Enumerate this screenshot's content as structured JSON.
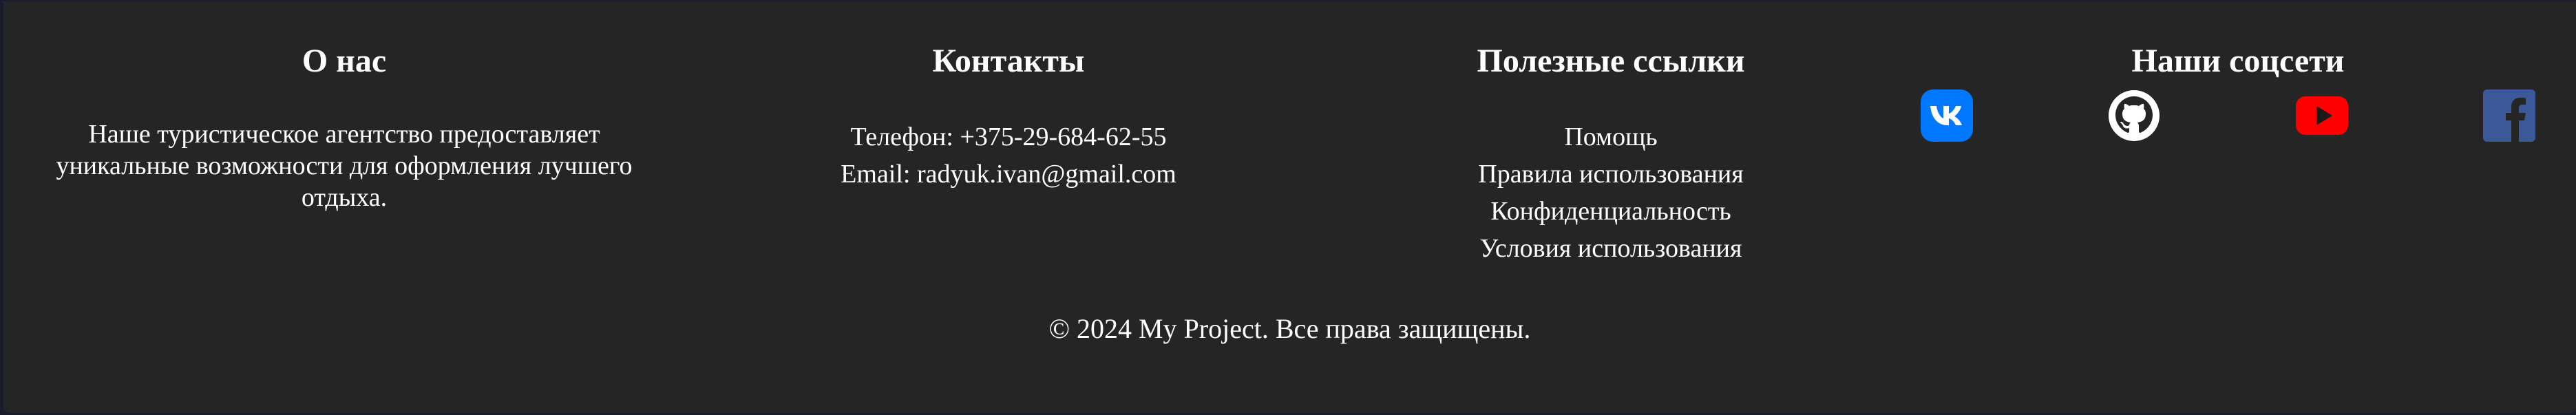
{
  "footer": {
    "about": {
      "title": "О нас",
      "text": "Наше туристическое агентство предоставляет уникальные возможности для оформления лучшего отдыха."
    },
    "contacts": {
      "title": "Контакты",
      "phone": "Телефон: +375-29-684-62-55",
      "email": "Email: radyuk.ivan@gmail.com"
    },
    "links": {
      "title": "Полезные ссылки",
      "items": [
        "Помощь",
        "Правила использования",
        "Конфиденциальность",
        "Условия использования"
      ]
    },
    "social": {
      "title": "Наши соцсети",
      "icons": [
        {
          "name": "vk-icon",
          "color": "#0077ff"
        },
        {
          "name": "github-icon",
          "color": "#ffffff"
        },
        {
          "name": "youtube-icon",
          "color": "#ff0000"
        },
        {
          "name": "facebook-icon",
          "color": "#3b5998"
        }
      ]
    },
    "copyright": "© 2024 My Project. Все права защищены."
  },
  "colors": {
    "background": "#1b1b2e",
    "footer_background": "#252525",
    "text": "#ffffff"
  }
}
